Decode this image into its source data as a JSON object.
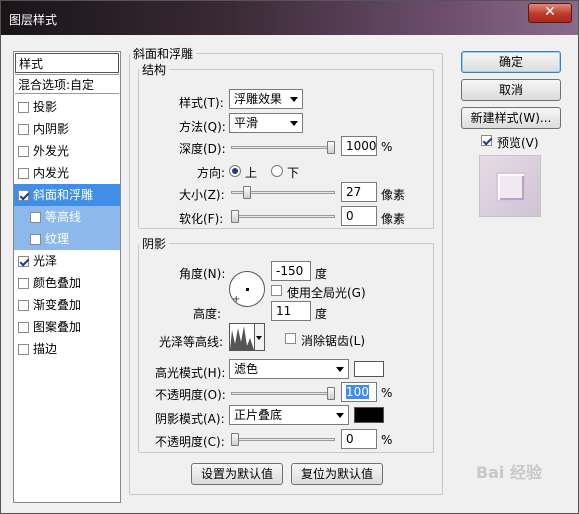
{
  "window": {
    "title": "图层样式",
    "close": "✕"
  },
  "style_list": {
    "header": "样式",
    "blend": "混合选项:自定",
    "items": [
      {
        "label": "投影",
        "checked": false
      },
      {
        "label": "内阴影",
        "checked": false
      },
      {
        "label": "外发光",
        "checked": false
      },
      {
        "label": "内发光",
        "checked": false
      },
      {
        "label": "斜面和浮雕",
        "checked": true,
        "selected": true
      },
      {
        "label": "等高线",
        "checked": false,
        "sub": true
      },
      {
        "label": "纹理",
        "checked": false,
        "sub": true
      },
      {
        "label": "光泽",
        "checked": true
      },
      {
        "label": "颜色叠加",
        "checked": false
      },
      {
        "label": "渐变叠加",
        "checked": false
      },
      {
        "label": "图案叠加",
        "checked": false
      },
      {
        "label": "描边",
        "checked": false
      }
    ]
  },
  "bevel": {
    "title": "斜面和浮雕",
    "structure": {
      "title": "结构",
      "style_label": "样式(T):",
      "style_value": "浮雕效果",
      "method_label": "方法(Q):",
      "method_value": "平滑",
      "depth_label": "深度(D):",
      "depth_value": "1000",
      "depth_unit": "%",
      "depth_level": 1.0,
      "direction_label": "方向:",
      "dir_up": "上",
      "dir_down": "下",
      "size_label": "大小(Z):",
      "size_value": "27",
      "size_unit": "像素",
      "soften_label": "软化(F):",
      "soften_value": "0",
      "soften_unit": "像素"
    },
    "shading": {
      "title": "阴影",
      "angle_label": "角度(N):",
      "angle_value": "-150",
      "angle_unit": "度",
      "global_light": "使用全局光(G)",
      "altitude_label": "高度:",
      "altitude_value": "11",
      "altitude_unit": "度",
      "gloss_label": "光泽等高线:",
      "antialias": "消除锯齿(L)",
      "highlight_mode_label": "高光模式(H):",
      "highlight_mode": "滤色",
      "highlight_color": "#ffffff",
      "opacity1_label": "不透明度(O):",
      "opacity1_value": "100",
      "opacity1_unit": "%",
      "shadow_mode_label": "阴影模式(A):",
      "shadow_mode": "正片叠底",
      "shadow_color": "#000000",
      "opacity2_label": "不透明度(C):",
      "opacity2_value": "0",
      "opacity2_unit": "%"
    },
    "set_default": "设置为默认值",
    "reset_default": "复位为默认值"
  },
  "buttons": {
    "ok": "确定",
    "cancel": "取消",
    "new_style": "新建样式(W)...",
    "preview": "预览(V)"
  },
  "watermark": "Bai 经验"
}
